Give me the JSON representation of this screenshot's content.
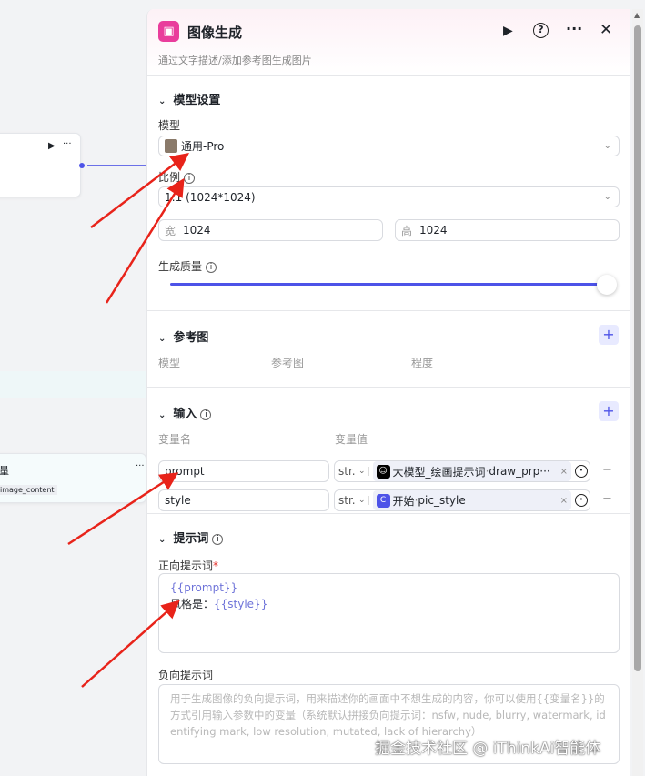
{
  "canvas": {
    "node_bottom_label": "量",
    "node_bottom_tag": "image_content"
  },
  "header": {
    "title": "图像生成",
    "subtitle": "通过文字描述/添加参考图生成图片"
  },
  "model_settings": {
    "title": "模型设置",
    "model_label": "模型",
    "model_value": "通用-Pro",
    "ratio_label": "比例",
    "ratio_value": "1:1 (1024*1024)",
    "width_label": "宽",
    "width_value": "1024",
    "height_label": "高",
    "height_value": "1024",
    "quality_label": "生成质量",
    "quality_value": 1.0
  },
  "reference": {
    "title": "参考图",
    "columns": [
      "模型",
      "参考图",
      "程度"
    ]
  },
  "input": {
    "title": "输入",
    "col_name": "变量名",
    "col_value": "变量值",
    "rows": [
      {
        "name": "prompt",
        "type": "str.",
        "source": "大模型_绘画提示词",
        "var": "draw_prp···"
      },
      {
        "name": "style",
        "type": "str.",
        "source": "开始",
        "var": "pic_style"
      }
    ]
  },
  "prompt": {
    "title": "提示词",
    "positive_label": "正向提示词",
    "required": "*",
    "pos_line1": "{{prompt}}",
    "pos_line2_text": "风格是：",
    "pos_line2_var": "{{style}}",
    "negative_label": "负向提示词",
    "negative_placeholder": "用于生成图像的负向提示词，用来描述你的画面中不想生成的内容，你可以使用{{变量名}}的方式引用输入参数中的变量（系统默认拼接负向提示词：nsfw, nude, blurry, watermark, identifying mark, low resolution, mutated, lack of hierarchy）"
  },
  "watermark": "掘金技术社区 @ iThinkAi智能体",
  "colors": {
    "accent": "#4d53e8",
    "arrow": "#e8231a",
    "icon_bg": "#e93d9c"
  }
}
